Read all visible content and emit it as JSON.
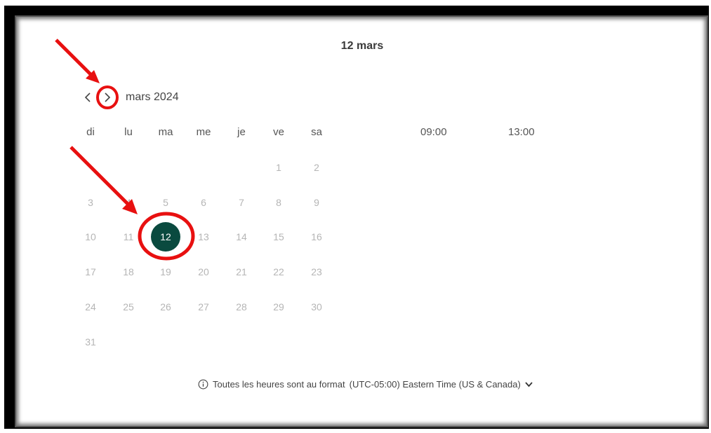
{
  "selected_date_title": "12 mars",
  "calendar": {
    "month_label": "mars 2024",
    "prev_icon": "chevron-left-icon",
    "next_icon": "chevron-right-icon",
    "weekdays": [
      "di",
      "lu",
      "ma",
      "me",
      "je",
      "ve",
      "sa"
    ],
    "weeks": [
      [
        "",
        "",
        "",
        "",
        "",
        "1",
        "2"
      ],
      [
        "3",
        "4",
        "5",
        "6",
        "7",
        "8",
        "9"
      ],
      [
        "10",
        "11",
        "12",
        "13",
        "14",
        "15",
        "16"
      ],
      [
        "17",
        "18",
        "19",
        "20",
        "21",
        "22",
        "23"
      ],
      [
        "24",
        "25",
        "26",
        "27",
        "28",
        "29",
        "30"
      ],
      [
        "31",
        "",
        "",
        "",
        "",
        "",
        ""
      ]
    ],
    "selected_day": "12",
    "selected_color": "#0a4a3f"
  },
  "time_slots": [
    "09:00",
    "13:00"
  ],
  "timezone": {
    "info_icon": "info-icon",
    "prefix": "Toutes les heures sont au format",
    "zone": "(UTC-05:00) Eastern Time (US & Canada)",
    "dropdown_icon": "chevron-down-icon"
  },
  "annotations": {
    "arrow_color": "#e81010"
  }
}
